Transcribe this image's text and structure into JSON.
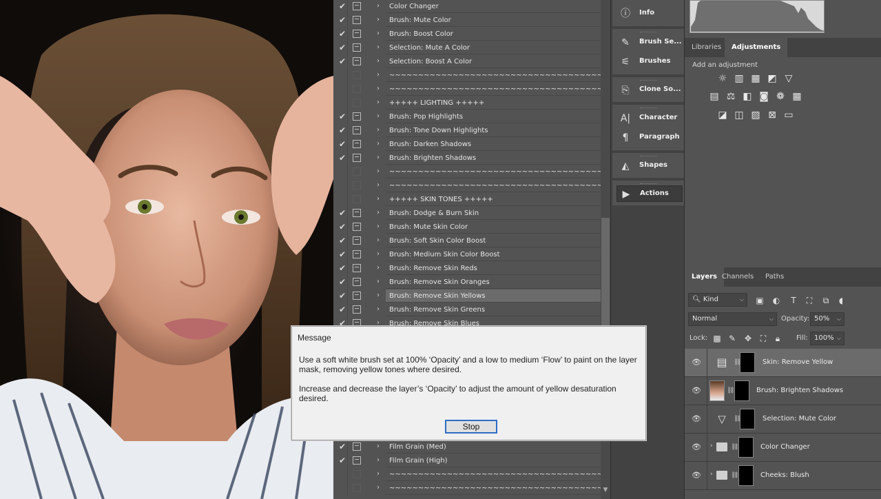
{
  "actions": {
    "rows": [
      {
        "checked": true,
        "dialog": true,
        "label": "Color Changer"
      },
      {
        "checked": true,
        "dialog": true,
        "label": "Brush: Mute Color"
      },
      {
        "checked": true,
        "dialog": true,
        "label": "Brush: Boost Color"
      },
      {
        "checked": true,
        "dialog": true,
        "label": "Selection: Mute A Color"
      },
      {
        "checked": true,
        "dialog": true,
        "label": "Selection: Boost A Color"
      },
      {
        "checked": false,
        "dialog": false,
        "label": "~~~~~~~~~~~~~~~~~~~~~~~~~~~~~~~~~~~~~~~~~"
      },
      {
        "checked": false,
        "dialog": false,
        "label": "~~~~~~~~~~~~~~~~~~~~~~~~~~~~~~~~~~~~~~~~~"
      },
      {
        "checked": false,
        "dialog": false,
        "label": "+++++ LIGHTING +++++"
      },
      {
        "checked": true,
        "dialog": true,
        "label": "Brush: Pop Highlights"
      },
      {
        "checked": true,
        "dialog": true,
        "label": "Brush: Tone Down Highlights"
      },
      {
        "checked": true,
        "dialog": true,
        "label": "Brush: Darken Shadows"
      },
      {
        "checked": true,
        "dialog": true,
        "label": "Brush: Brighten Shadows"
      },
      {
        "checked": false,
        "dialog": false,
        "label": "~~~~~~~~~~~~~~~~~~~~~~~~~~~~~~~~~~~~~~~~~"
      },
      {
        "checked": false,
        "dialog": false,
        "label": "~~~~~~~~~~~~~~~~~~~~~~~~~~~~~~~~~~~~~~~~~"
      },
      {
        "checked": false,
        "dialog": false,
        "label": "+++++ SKIN TONES +++++"
      },
      {
        "checked": true,
        "dialog": true,
        "label": "Brush: Dodge & Burn Skin"
      },
      {
        "checked": true,
        "dialog": true,
        "label": "Brush: Mute Skin Color"
      },
      {
        "checked": true,
        "dialog": true,
        "label": "Brush: Soft Skin Color Boost"
      },
      {
        "checked": true,
        "dialog": true,
        "label": "Brush: Medium Skin Color Boost"
      },
      {
        "checked": true,
        "dialog": true,
        "label": "Brush: Remove Skin Reds"
      },
      {
        "checked": true,
        "dialog": true,
        "label": "Brush: Remove Skin Oranges"
      },
      {
        "checked": true,
        "dialog": true,
        "label": "Brush: Remove Skin Yellows",
        "selected": true
      },
      {
        "checked": true,
        "dialog": true,
        "label": "Brush: Remove Skin Greens"
      },
      {
        "checked": true,
        "dialog": true,
        "label": "Brush: Remove Skin Blues"
      }
    ],
    "bottom_rows": [
      {
        "checked": true,
        "dialog": true,
        "label": "Film Grain (Med)"
      },
      {
        "checked": true,
        "dialog": true,
        "label": "Film Grain (High)"
      },
      {
        "checked": false,
        "dialog": false,
        "label": "~~~~~~~~~~~~~~~~~~~~~~~~~~~~~~~~~~~~~~~~~"
      },
      {
        "checked": false,
        "dialog": false,
        "label": "~~~~~~~~~~~~~~~~~~~~~~~~~~~~~~~~~~~~~~~~~"
      }
    ]
  },
  "dock": {
    "info": "Info",
    "brush_settings": "Brush Se...",
    "brushes": "Brushes",
    "clone_source": "Clone So...",
    "character": "Character",
    "paragraph": "Paragraph",
    "shapes": "Shapes",
    "actions": "Actions"
  },
  "adjustments": {
    "tabs": [
      "Libraries",
      "Adjustments"
    ],
    "active_tab": "Adjustments",
    "add_label": "Add an adjustment"
  },
  "layers": {
    "tabs": [
      "Layers",
      "Channels",
      "Paths"
    ],
    "active_tab": "Layers",
    "filter_kind": "Kind",
    "blend_mode": "Normal",
    "opacity_label": "Opacity:",
    "opacity": "50%",
    "lock_label": "Lock:",
    "fill_label": "Fill:",
    "fill": "100%",
    "items": [
      {
        "name": "Skin: Remove Yellow",
        "kind": "adjustment",
        "selected": true
      },
      {
        "name": "Brush: Brighten Shadows",
        "kind": "image"
      },
      {
        "name": "Selection: Mute Color",
        "kind": "adjustment-triangle"
      },
      {
        "name": "Color Changer",
        "kind": "group"
      },
      {
        "name": "Cheeks: Blush",
        "kind": "group"
      }
    ]
  },
  "dialog": {
    "title": "Message",
    "paragraph1": "Use a soft white brush set at 100% ‘Opacity’ and a low to medium ‘Flow’ to paint on the layer mask, removing yellow tones where desired.",
    "paragraph2": "Increase and decrease the layer’s ‘Opacity’ to adjust the amount of yellow desaturation desired.",
    "stop_label": "Stop"
  },
  "colors": {
    "panel_bg": "#535353",
    "dock_bg": "#424242",
    "selected_row": "#6b6b6b",
    "dialog_bg": "#f0f0f0",
    "button_border": "#2d6cc7"
  }
}
